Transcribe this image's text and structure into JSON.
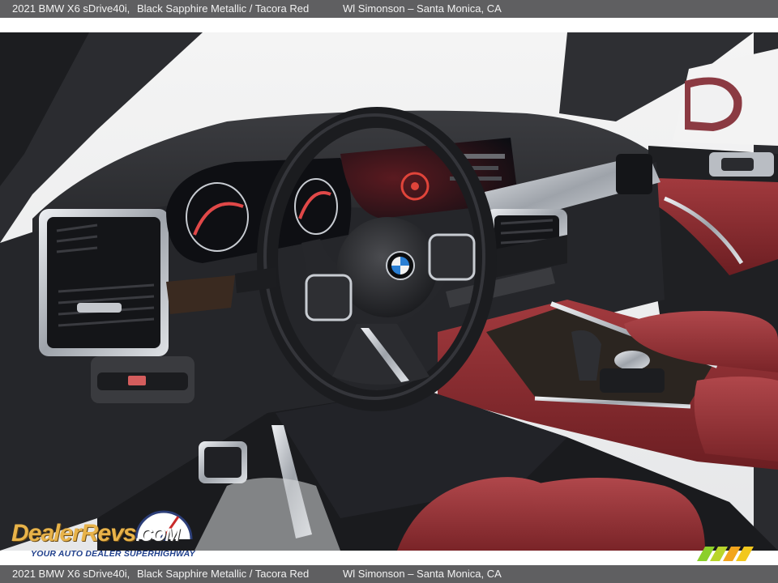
{
  "header": {
    "vehicle": "2021 BMW X6 sDrive40i,",
    "color": "Black Sapphire Metallic / Tacora Red",
    "dealer": "Wl Simonson – Santa Monica, CA"
  },
  "footer": {
    "vehicle": "2021 BMW X6 sDrive40i,",
    "color": "Black Sapphire Metallic / Tacora Red",
    "dealer": "Wl Simonson – Santa Monica, CA"
  },
  "watermark": {
    "brand": "DealerRevs",
    "suffix": ".COM",
    "tagline": "YOUR AUTO DEALER SUPERHIGHWAY"
  },
  "colors": {
    "bar": "#5f5f61",
    "leather": "#8c2b30",
    "dash": "#2a2b2e",
    "trim": "#c8ccd2"
  }
}
